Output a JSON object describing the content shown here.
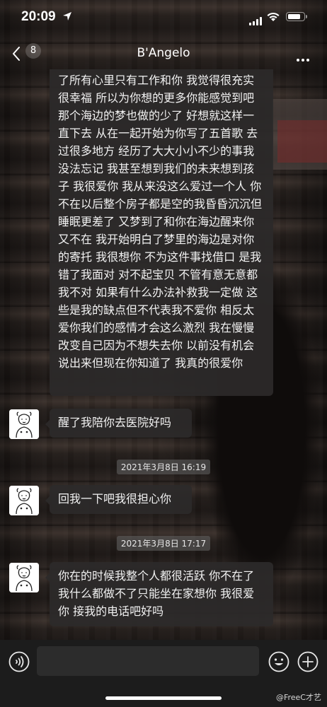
{
  "status_bar": {
    "time": "20:09",
    "signal_bars": 4,
    "wifi": "wifi-icon",
    "battery_level": 0.85
  },
  "nav": {
    "back_icon": "chevron-left-icon",
    "unread_count": "8",
    "title": "B'Angelo",
    "more_icon": "more-horizontal-icon"
  },
  "messages": [
    {
      "type": "text",
      "text": "了所有心里只有工作和你 我觉得很充实很幸福 所以为你想的更多你能感觉到吧 那个海边的梦也做的少了 好想就这样一直下去 从在一起开始为你写了五首歌 去过很多地方 经历了大大小小不少的事我没法忘记 我甚至想到我们的未来想到孩子 我很爱你 我从来没这么爱过一个人 你不在以后整个房子都是空的我昏昏沉沉但睡眠更差了 又梦到了和你在海边醒来你又不在 我开始明白了梦里的海边是对你的寄托 我很想你 不为这件事找借口 是我错了我面对 对不起宝贝 不管有意无意都我不对 如果有什么办法补救我一定做 这些是我的缺点但不代表我不爱你 相反太爱你我们的感情才会这么激烈 我在慢慢改变自己因为不想失去你 以前没有机会说出来但现在你知道了 我真的很爱你"
    },
    {
      "type": "text",
      "text": "醒了我陪你去医院好吗"
    },
    {
      "type": "timestamp",
      "text": "2021年3月8日 16:19"
    },
    {
      "type": "text",
      "text": "回我一下吧我很担心你"
    },
    {
      "type": "timestamp",
      "text": "2021年3月8日 17:17"
    },
    {
      "type": "text",
      "text": "你在的时候我整个人都很活跃 你不在了我什么都做不了只能坐在家想你 我很爱你 接我的电话吧好吗"
    }
  ],
  "input_bar": {
    "voice_icon": "voice-icon",
    "emoji_icon": "emoji-icon",
    "plus_icon": "plus-icon",
    "input_value": ""
  },
  "watermark": "@FreeC才艺"
}
